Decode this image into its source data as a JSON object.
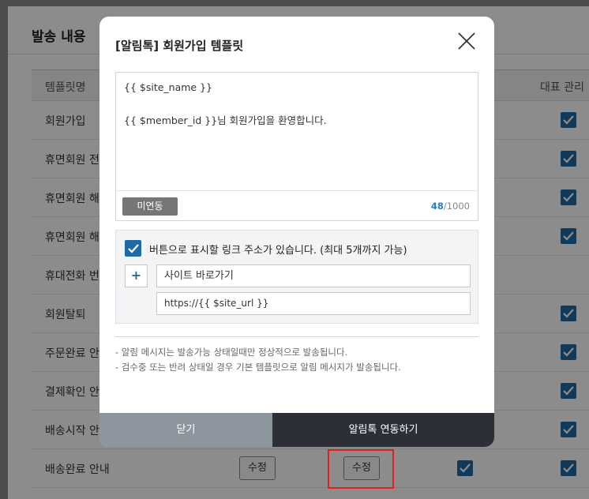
{
  "background": {
    "section_title": "발송 내용",
    "table": {
      "col_template_name": "템플릿명",
      "col_representative": "대표 관리",
      "rows": [
        {
          "name": "회원가입"
        },
        {
          "name": "휴면회원 전"
        },
        {
          "name": "휴면회원 해"
        },
        {
          "name": "휴면회원 해"
        },
        {
          "name": "휴대전화 번"
        },
        {
          "name": "회원탈퇴"
        },
        {
          "name": "주문완료 안"
        },
        {
          "name": "결제확인 안"
        },
        {
          "name": "배송시작 안"
        },
        {
          "name": "배송완료 안내"
        }
      ],
      "edit_label": "수정"
    }
  },
  "modal": {
    "title": "[알림톡] 회원가입 템플릿",
    "message_line1": "{{ $site_name }}",
    "message_line2": "{{ $member_id }}님 회원가입을 환영합니다.",
    "status_tag": "미연동",
    "char_count": "48",
    "char_max": "/1000",
    "link_checkbox_label": "버튼으로 표시할 링크 주소가 있습니다. (최대 5개까지 가능)",
    "add_button": "+",
    "link_name_value": "사이트 바로가기",
    "link_url_value": "https://{{ $site_url }}",
    "note1": "- 알림 메시지는 발송가능 상태일때만 정상적으로 발송됩니다.",
    "note2": "- 검수중 또는 반려 상태일 경우 기본 템플릿으로 알림 메시지가 발송됩니다.",
    "close_button": "닫기",
    "link_button": "알림톡 연동하기"
  },
  "colors": {
    "accent": "#1f6aa5",
    "highlight": "#e02020",
    "footer_close": "#8d959e",
    "footer_primary": "#2c3036"
  }
}
